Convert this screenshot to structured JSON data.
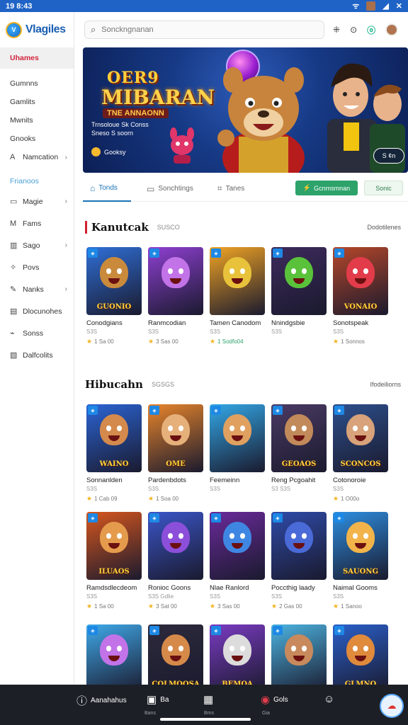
{
  "status": {
    "time": "19 8:43"
  },
  "app": {
    "name": "Vlagiles"
  },
  "sidebar": {
    "items": [
      {
        "label": "Uhames",
        "icon": "",
        "active": true
      },
      {
        "label": "Gumnns",
        "icon": ""
      },
      {
        "label": "Gamlits",
        "icon": ""
      },
      {
        "label": "Mwnits",
        "icon": ""
      },
      {
        "label": "Gnooks",
        "icon": ""
      },
      {
        "label": "Namcation",
        "icon": "text-icon",
        "chevron": true
      },
      {
        "label": "Frianoos",
        "icon": "",
        "group": true
      },
      {
        "label": "Magie",
        "icon": "folder-icon",
        "chevron": true
      },
      {
        "label": "Fams",
        "icon": "mail-icon"
      },
      {
        "label": "Sago",
        "icon": "panel-icon",
        "chevron": true
      },
      {
        "label": "Povs",
        "icon": "puzzle-icon"
      },
      {
        "label": "Nanks",
        "icon": "edit-icon",
        "chevron": true
      },
      {
        "label": "Dlocunohes",
        "icon": "document-icon"
      },
      {
        "label": "Sonss",
        "icon": "link-icon"
      },
      {
        "label": "Dalfcolits",
        "icon": "clipboard-icon"
      }
    ]
  },
  "search": {
    "placeholder": "Sonckngnanan",
    "value": ""
  },
  "banner": {
    "title_line1": "OER9",
    "title_line2": "MIBARAN",
    "title_line3": "TNE ANNAONN",
    "info_line1": "Trnsoloue Sk Conss",
    "info_line2": "Sneso S soorn",
    "badge_label": "Gooksy",
    "button_label": "S ¢n"
  },
  "tabs": [
    {
      "label": "Tonds",
      "icon": "home-icon",
      "active": true
    },
    {
      "label": "Sonchtings",
      "icon": "chat-icon"
    },
    {
      "label": "Tanes",
      "icon": "tag-icon"
    }
  ],
  "actions": {
    "primary_label": "Gcnmsmnan",
    "secondary_label": "Sonic"
  },
  "section1": {
    "title": "Kanutcak",
    "subtitle": "SUSCO",
    "more": "Dodotilenes"
  },
  "section2": {
    "title": "Hibucahn",
    "subtitle": "SGSGS",
    "more": "Ifodeiliorns"
  },
  "row1": [
    {
      "name": "Conodgians",
      "meta": "S3S",
      "rating": "1 Sa 00",
      "word": "GUONIO",
      "bg": "#2f6fd6",
      "face": "#c98a3c"
    },
    {
      "name": "Ranmcodian",
      "meta": "S3S",
      "rating": "3 Sas 00",
      "word": "",
      "bg": "#8e3fd1",
      "face": "#c273e8"
    },
    {
      "name": "Tamen Canodom",
      "meta": "S3S",
      "rating": "1 Sodfo04",
      "word": "",
      "bg": "#f0a324",
      "face": "#e8c23a",
      "green": true
    },
    {
      "name": "Nnindgsbie",
      "meta": "S3S",
      "rating": "",
      "word": "",
      "bg": "#3d2a5c",
      "face": "#59c23a"
    },
    {
      "name": "Sonotspeak",
      "meta": "S3S",
      "rating": "1 Sonnos",
      "word": "VONAIO",
      "bg": "#b5472a",
      "face": "#e23c4a"
    }
  ],
  "row2": [
    {
      "name": "Sonnanlden",
      "meta": "S3S",
      "rating": "1 Cab 09",
      "word": "WAINO",
      "bg": "#2b64d4",
      "face": "#d48a4c"
    },
    {
      "name": "Pardenbdots",
      "meta": "S3S",
      "rating": "1 Soa 00",
      "word": "OME",
      "bg": "#e8852c",
      "face": "#e6b07a"
    },
    {
      "name": "Feemeinn",
      "meta": "S3S",
      "rating": "",
      "word": "",
      "bg": "#33a7e6",
      "face": "#e0a060"
    },
    {
      "name": "Reng Pcgoahit",
      "meta": "S3 S3S",
      "rating": "",
      "word": "GEOAOS",
      "bg": "#4b3a63",
      "face": "#c28a5a"
    },
    {
      "name": "Cotonoroie",
      "meta": "S3S",
      "rating": "1 O00o",
      "word": "SCONCOS",
      "bg": "#2d4f8c",
      "face": "#d8a27a"
    }
  ],
  "row3": [
    {
      "name": "Ramdsdlecdeom",
      "meta": "S3S",
      "rating": "1 Sa 00",
      "word": "ILUAOS",
      "bg": "#d6561e",
      "face": "#e59b4c"
    },
    {
      "name": "Ronioc Goons",
      "meta": "S3S Gdlie",
      "rating": "3 Sat 00",
      "word": "",
      "bg": "#3b55c8",
      "face": "#8c4fd9"
    },
    {
      "name": "Nlae Ranlord",
      "meta": "S3S",
      "rating": "3 Sas 00",
      "word": "",
      "bg": "#6a2a9a",
      "face": "#3f86e3"
    },
    {
      "name": "Poccthig laady",
      "meta": "S3S",
      "rating": "2 Gas 00",
      "word": "",
      "bg": "#2f4aa8",
      "face": "#4a6ad8"
    },
    {
      "name": "Naimal Gooms",
      "meta": "S3S",
      "rating": "1 Sanoo",
      "word": "SAUONG",
      "bg": "#2e8ee0",
      "face": "#f2b44a"
    }
  ],
  "row4": [
    {
      "word": "",
      "bg": "#3fa8e8",
      "face": "#c273e8"
    },
    {
      "word": "COLMOOSA",
      "bg": "#2d2a3c",
      "face": "#d68a4a"
    },
    {
      "word": "BEMOA",
      "bg": "#7a3bc2",
      "face": "#dcdcdc"
    },
    {
      "word": "",
      "bg": "#4cb3e0",
      "face": "#c88a5c"
    },
    {
      "word": "GLMNO",
      "bg": "#2a5fc9",
      "face": "#e08a3c"
    }
  ],
  "bottomnav": {
    "item1": "Aanahahus",
    "item2": "Ba",
    "item2_sub": "Bans",
    "item3_sub": "Bms",
    "item4": "Gols",
    "item4_sub": "Gia"
  }
}
